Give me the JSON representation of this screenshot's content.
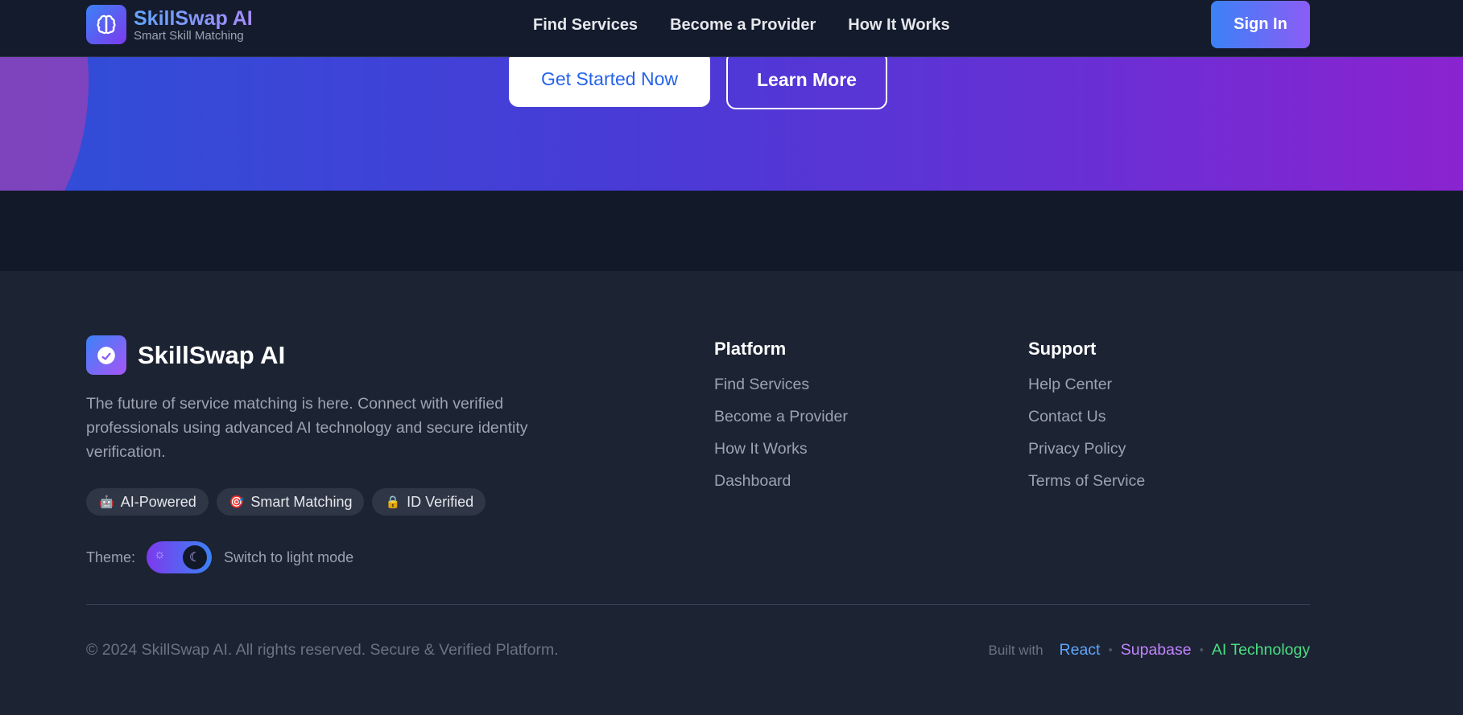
{
  "header": {
    "brand_name": "SkillSwap AI",
    "brand_tagline": "Smart Skill Matching",
    "brand_icon": "brain-icon",
    "nav": [
      "Find Services",
      "Become a Provider",
      "How It Works"
    ],
    "sign_in_label": "Sign In"
  },
  "hero": {
    "primary_cta": "Get Started Now",
    "secondary_cta": "Learn More"
  },
  "footer": {
    "brand_name": "SkillSwap AI",
    "brand_icon": "gauge-icon",
    "description": "The future of service matching is here. Connect with verified professionals using advanced AI technology and secure identity verification.",
    "badges": [
      {
        "icon": "robot-icon",
        "label": "AI-Powered"
      },
      {
        "icon": "target-icon",
        "label": "Smart Matching"
      },
      {
        "icon": "lock-icon",
        "label": "ID Verified"
      }
    ],
    "theme": {
      "label": "Theme:",
      "action_text": "Switch to light mode",
      "mode": "dark"
    },
    "platform": {
      "heading": "Platform",
      "links": [
        "Find Services",
        "Become a Provider",
        "How It Works",
        "Dashboard"
      ]
    },
    "support": {
      "heading": "Support",
      "links": [
        "Help Center",
        "Contact Us",
        "Privacy Policy",
        "Terms of Service"
      ]
    },
    "copyright": "© 2024 SkillSwap AI. All rights reserved. Secure & Verified Platform.",
    "built_with": {
      "label": "Built with",
      "separator": "•",
      "tech": [
        "React",
        "Supabase",
        "AI Technology"
      ]
    }
  },
  "colors": {
    "accent_blue": "#3b82f6",
    "accent_purple": "#8b5cf6",
    "react": "#60a5fa",
    "supabase": "#c084fc",
    "ai_technology": "#4ade80"
  }
}
